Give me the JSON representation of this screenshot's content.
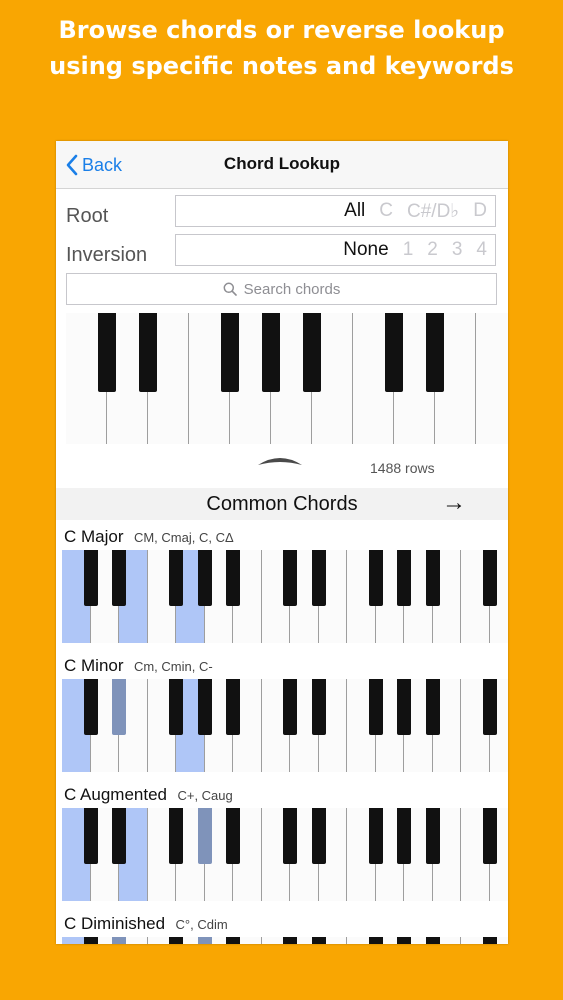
{
  "promo": {
    "line1": "Browse chords or reverse lookup",
    "line2": "using specific notes and keywords"
  },
  "navbar": {
    "back_label": "Back",
    "title": "Chord Lookup"
  },
  "root_row": {
    "label": "Root",
    "selected": "All",
    "options": [
      "C",
      "C#/D♭",
      "D"
    ]
  },
  "inversion_row": {
    "label": "Inversion",
    "selected": "None",
    "options": [
      "1",
      "2",
      "3",
      "4"
    ]
  },
  "search": {
    "placeholder": "Search chords"
  },
  "results": {
    "count_label": "1488 rows"
  },
  "section": {
    "title": "Common Chords",
    "arrow": "→"
  },
  "chords": [
    {
      "name": "C Major",
      "aliases": "CM, Cmaj, C, CΔ",
      "highlight_white": [
        0,
        2,
        4
      ],
      "highlight_black": []
    },
    {
      "name": "C Minor",
      "aliases": "Cm, Cmin, C-",
      "highlight_white": [
        0,
        4
      ],
      "highlight_black": [
        1
      ]
    },
    {
      "name": "C Augmented",
      "aliases": "C+, Caug",
      "highlight_white": [
        0,
        2
      ],
      "highlight_black": [
        3
      ]
    },
    {
      "name": "C Diminished",
      "aliases": "C°, Cdim",
      "highlight_white": [
        0
      ],
      "highlight_black": [
        1,
        3
      ]
    }
  ],
  "colors": {
    "background": "#F9A602",
    "accent": "#1A7FE8",
    "highlight_white_key": "#AFC6F7",
    "highlight_black_key": "#7F93BA"
  }
}
